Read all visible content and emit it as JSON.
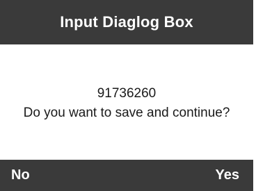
{
  "dialog": {
    "title": "Input Diaglog Box",
    "value": "91736260",
    "message": "Do you want to save and continue?"
  },
  "softkeys": {
    "left_label": "No",
    "right_label": "Yes"
  },
  "colors": {
    "bar_background": "#3a3a3a",
    "bar_text": "#ffffff",
    "body_background": "#ffffff",
    "body_text": "#1a1a1a"
  }
}
